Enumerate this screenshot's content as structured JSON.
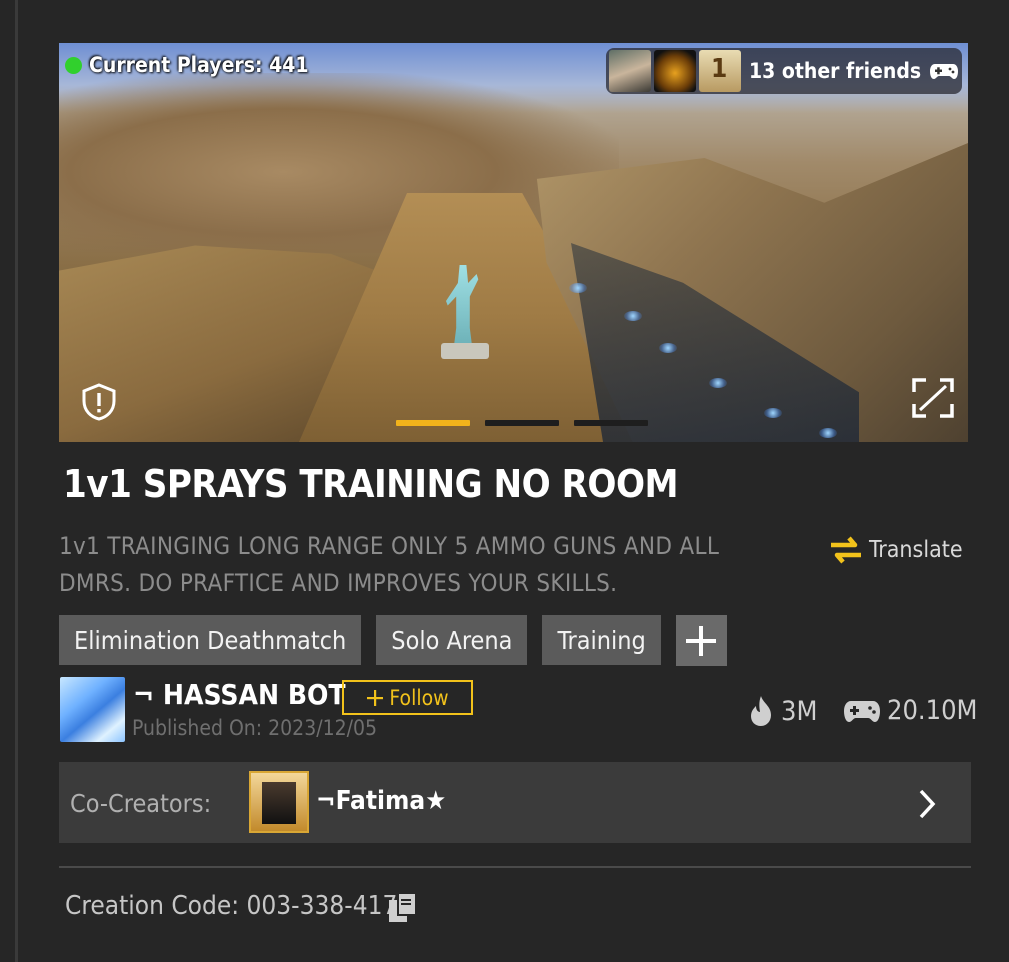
{
  "banner": {
    "players_text": "Current Players: 441",
    "friends_text": "13 other friends",
    "slides_total": 3,
    "active_slide": 1
  },
  "map": {
    "title": "1v1 SPRAYS TRAINING NO ROOM",
    "description": "1v1 TRAINGING LONG RANGE ONLY 5 AMMO GUNS AND ALL DMRS.  DO PRAFTICE AND IMPROVES YOUR SKILLS.",
    "translate_label": "Translate",
    "tags": [
      "Elimination Deathmatch",
      "Solo Arena",
      "Training"
    ]
  },
  "creator": {
    "name": "¬ HASSAN  BOT",
    "follow_label": "Follow",
    "published": "Published On: 2023/12/05",
    "popularity": "3M",
    "plays": "20.10M"
  },
  "co_creators": {
    "label": "Co-Creators:",
    "name": "¬Fatima★"
  },
  "creation_code": "Creation Code: 003-338-417",
  "colors": {
    "accent": "#f2b31b",
    "online": "#31d02d"
  }
}
